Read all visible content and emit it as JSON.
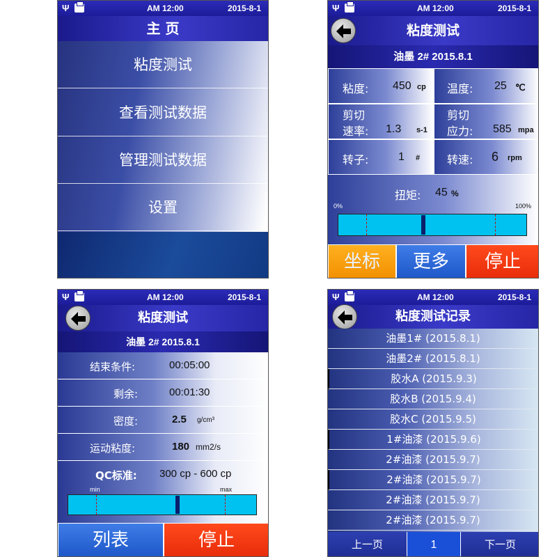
{
  "status": {
    "time": "AM 12:00",
    "date": "2015-8-1"
  },
  "screen1": {
    "title": "主 页",
    "menu": [
      "粘度测试",
      "查看测试数据",
      "管理测试数据",
      "设置"
    ]
  },
  "screen2": {
    "title": "粘度测试",
    "sample": "油墨 2# 2015.8.1",
    "viscosity": {
      "label": "粘度:",
      "value": "450",
      "unit": "cp"
    },
    "temperature": {
      "label": "温度:",
      "value": "25",
      "unit": "℃"
    },
    "shear_rate": {
      "label1": "剪切",
      "label2": "速率:",
      "value": "1.3",
      "unit": "s-1"
    },
    "shear_stress": {
      "label1": "剪切",
      "label2": "应力:",
      "value": "585",
      "unit": "mpa"
    },
    "rotor": {
      "label": "转子:",
      "value": "1",
      "unit": "#"
    },
    "speed": {
      "label": "转速:",
      "value": "6",
      "unit": "rpm"
    },
    "torque": {
      "label": "扭矩:",
      "value": "45",
      "unit": "%",
      "min_label": "0%",
      "max_label": "100%",
      "fraction": 0.45
    },
    "buttons": {
      "coord": "坐标",
      "more": "更多",
      "stop": "停止"
    },
    "colors": {
      "orange": "#f29000",
      "blue": "#1e57c8",
      "red": "#e82c0a"
    }
  },
  "screen3": {
    "title": "粘度测试",
    "sample": "油墨 2# 2015.8.1",
    "end_condition": {
      "label": "结束条件:",
      "value": "00:05:00"
    },
    "remaining": {
      "label": "剩余:",
      "value": "00:01:30"
    },
    "density": {
      "label": "密度:",
      "value": "2.5",
      "unit": "g/cm³"
    },
    "kinematic": {
      "label": "运动粘度:",
      "value": "180",
      "unit": "mm2/s"
    },
    "qc": {
      "label": "QC标准:",
      "value": "300 cp - 600 cp",
      "min_label": "min",
      "max_label": "max",
      "fraction": 0.58
    },
    "buttons": {
      "list": "列表",
      "stop": "停止"
    }
  },
  "screen4": {
    "title": "粘度测试记录",
    "records": [
      "油墨1# (2015.8.1)",
      "油墨2# (2015.8.1)",
      "胶水A (2015.9.3)",
      "胶水B (2015.9.4)",
      "胶水C (2015.9.5)",
      "1#油漆 (2015.9.6)",
      "2#油漆 (2015.9.7)",
      "2#油漆 (2015.9.7)",
      "2#油漆 (2015.9.7)",
      "2#油漆 (2015.9.7)"
    ],
    "pager": {
      "prev": "上一页",
      "page": "1",
      "next": "下一页"
    }
  }
}
